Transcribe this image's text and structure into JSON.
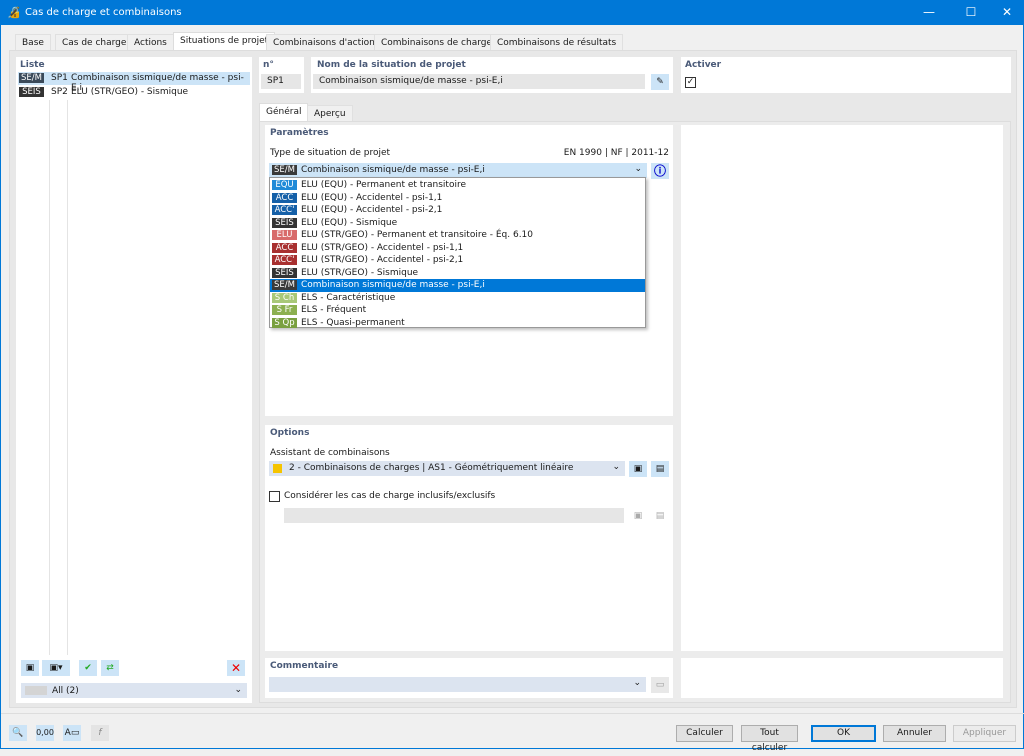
{
  "window": {
    "title": "Cas de charge et combinaisons",
    "minimize": "—",
    "maximize": "☐",
    "close": "✕"
  },
  "tabs": [
    "Base",
    "Cas de charge",
    "Actions",
    "Situations de projet",
    "Combinaisons d'actions",
    "Combinaisons de charges",
    "Combinaisons de résultats"
  ],
  "list": {
    "header": "Liste",
    "items": [
      {
        "badge": "SE/M",
        "id": "SP1",
        "label": "Combinaison sismique/de masse - psi-E,i",
        "color": "#3a4a5a"
      },
      {
        "badge": "SEIS",
        "id": "SP2",
        "label": "ELU (STR/GEO) - Sismique",
        "color": "#333333"
      }
    ],
    "filter": "All (2)"
  },
  "number": {
    "label": "n°",
    "value": "SP1"
  },
  "name": {
    "label": "Nom de la situation de projet",
    "value": "Combinaison sismique/de masse - psi-E,i"
  },
  "activate": {
    "label": "Activer",
    "checked": "✓"
  },
  "subtabs": [
    "Général",
    "Aperçu"
  ],
  "params": {
    "header": "Paramètres",
    "type_label": "Type de situation de projet",
    "norm": "EN 1990 | NF | 2011-12",
    "selected_badge": "SE/M",
    "selected": "Combinaison sismique/de masse - psi-E,i",
    "options": [
      {
        "badge": "EQU",
        "label": "ELU (EQU) - Permanent et transitoire",
        "color": "#1f8ad8"
      },
      {
        "badge": "ACC",
        "label": "ELU (EQU) - Accidentel - psi-1,1",
        "color": "#1560a8"
      },
      {
        "badge": "ACC'",
        "label": "ELU (EQU) - Accidentel - psi-2,1",
        "color": "#1560a8"
      },
      {
        "badge": "SEIS",
        "label": "ELU (EQU) - Sismique",
        "color": "#333333"
      },
      {
        "badge": "ELU",
        "label": "ELU (STR/GEO) - Permanent et transitoire - Éq. 6.10",
        "color": "#d86a6a"
      },
      {
        "badge": "ACC",
        "label": "ELU (STR/GEO) - Accidentel - psi-1,1",
        "color": "#a83030"
      },
      {
        "badge": "ACC'",
        "label": "ELU (STR/GEO) - Accidentel - psi-2,1",
        "color": "#a83030"
      },
      {
        "badge": "SEIS",
        "label": "ELU (STR/GEO) - Sismique",
        "color": "#333333"
      },
      {
        "badge": "SE/M",
        "label": "Combinaison sismique/de masse - psi-E,i",
        "color": "#3a3a3a",
        "selected": true
      },
      {
        "badge": "S Ch",
        "label": "ELS - Caractéristique",
        "color": "#a8c878"
      },
      {
        "badge": "S Fr",
        "label": "ELS - Fréquent",
        "color": "#8cb050"
      },
      {
        "badge": "S Qp",
        "label": "ELS - Quasi-permanent",
        "color": "#7aa040"
      }
    ]
  },
  "options": {
    "header": "Options",
    "assistant_label": "Assistant de combinaisons",
    "assistant_value": "2 - Combinaisons de charges | AS1 - Géométriquement linéaire",
    "assistant_color": "#f5c400",
    "inclusive_label": "Considérer les cas de charge inclusifs/exclusifs"
  },
  "comment": {
    "header": "Commentaire"
  },
  "buttons": {
    "calc": "Calculer",
    "calc_all": "Tout calculer",
    "ok": "OK",
    "cancel": "Annuler",
    "apply": "Appliquer"
  }
}
